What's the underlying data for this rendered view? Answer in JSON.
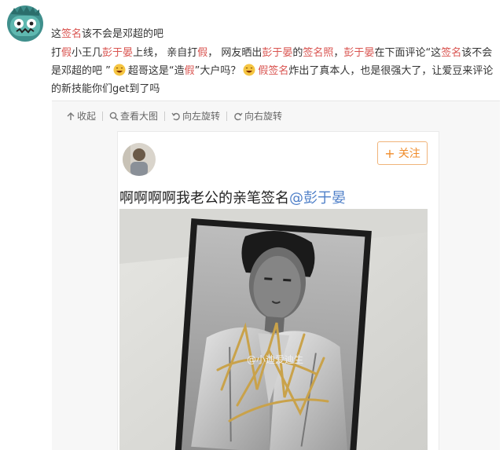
{
  "post": {
    "title_prefix": "这",
    "title_hl": "签名",
    "title_suffix": "该不会是邓超的吧",
    "body": [
      {
        "t": "打",
        "hl": false
      },
      {
        "t": "假",
        "hl": true
      },
      {
        "t": "小王几",
        "hl": false
      },
      {
        "t": "彭于晏",
        "hl": true
      },
      {
        "t": "上线，  亲自打",
        "hl": false
      },
      {
        "t": "假",
        "hl": true
      },
      {
        "t": "，  网友晒出",
        "hl": false
      },
      {
        "t": "彭于晏",
        "hl": true
      },
      {
        "t": "的",
        "hl": false
      },
      {
        "t": "签名照",
        "hl": true
      },
      {
        "t": "，",
        "hl": false
      },
      {
        "t": "彭于晏",
        "hl": true
      },
      {
        "t": "在下面评论“这",
        "hl": false
      },
      {
        "t": "签名",
        "hl": true
      },
      {
        "t": "该不会是邓超的吧 ”",
        "hl": false
      },
      {
        "t": "",
        "emoji": true
      },
      {
        "t": "超哥这是“造",
        "hl": false
      },
      {
        "t": "假",
        "hl": true
      },
      {
        "t": "”大户吗？",
        "hl": false
      },
      {
        "t": "",
        "emoji": true
      },
      {
        "t": "假签名",
        "hl": true
      },
      {
        "t": "炸出了真本人，也是很强大了，让爱豆来评论的新技能你们get到了吗",
        "hl": false
      }
    ]
  },
  "toolbar": {
    "collapse": "收起",
    "view_large": "查看大图",
    "rotate_left": "向左旋转",
    "rotate_right": "向右旋转"
  },
  "card": {
    "follow_label": "关注",
    "text": "啊啊啊啊我老公的亲笔签名",
    "mention": "@彭于晏"
  },
  "photo": {
    "watermark": "@小迪爱迪生"
  },
  "colors": {
    "highlight": "#d9534f",
    "mention": "#4e7fc8",
    "follow": "#f08c2b"
  }
}
